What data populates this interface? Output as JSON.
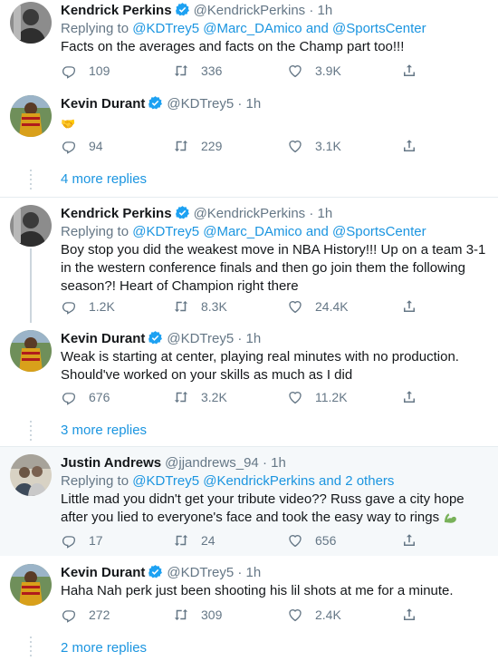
{
  "colors": {
    "link": "#1b95e0",
    "muted": "#657786",
    "text": "#14171a",
    "verified": "#1da1f2",
    "thread_line": "#ccd6dd"
  },
  "icons": {
    "reply": "reply-icon",
    "retweet": "retweet-icon",
    "like": "like-icon",
    "share": "share-icon",
    "verified": "verified-badge-icon"
  },
  "tweets": [
    {
      "name": "Kendrick Perkins",
      "handle": "@KendrickPerkins",
      "time": "· 1h",
      "replying_prefix": "Replying to",
      "replying_to": "@KDTrey5 @Marc_DAmico and @SportsCenter",
      "text": "Facts on the averages and facts on the Champ part too!!!",
      "replies": "109",
      "retweets": "336",
      "likes": "3.9K"
    },
    {
      "name": "Kevin Durant",
      "handle": "@KDTrey5",
      "time": "· 1h",
      "text": "🤝",
      "replies": "94",
      "retweets": "229",
      "likes": "3.1K",
      "more_replies": "4 more replies"
    },
    {
      "name": "Kendrick Perkins",
      "handle": "@KendrickPerkins",
      "time": "· 1h",
      "replying_prefix": "Replying to",
      "replying_to": "@KDTrey5 @Marc_DAmico and @SportsCenter",
      "text": "Boy stop you did the weakest move in NBA History!!! Up on a team 3-1 in the western conference finals and then go join them the following season?! Heart of Champion right there",
      "replies": "1.2K",
      "retweets": "8.3K",
      "likes": "24.4K"
    },
    {
      "name": "Kevin Durant",
      "handle": "@KDTrey5",
      "time": "· 1h",
      "text": "Weak is starting at center, playing real minutes with no production. Should've worked on your skills as much as I did",
      "replies": "676",
      "retweets": "3.2K",
      "likes": "11.2K",
      "more_replies": "3 more replies"
    },
    {
      "name": "Justin Andrews",
      "handle": "@jjandrews_94",
      "time": "· 1h",
      "replying_prefix": "Replying to",
      "replying_to": "@KDTrey5 @KendrickPerkins and 2 others",
      "text": "Little mad you didn't get your tribute video?? Russ gave a city hope after you lied to everyone's face and took the easy way to rings",
      "replies": "17",
      "retweets": "24",
      "likes": "656"
    },
    {
      "name": "Kevin Durant",
      "handle": "@KDTrey5",
      "time": "· 1h",
      "text": "Haha Nah perk just been shooting his lil shots at me for a minute.",
      "replies": "272",
      "retweets": "309",
      "likes": "2.4K",
      "more_replies": "2 more replies"
    }
  ]
}
